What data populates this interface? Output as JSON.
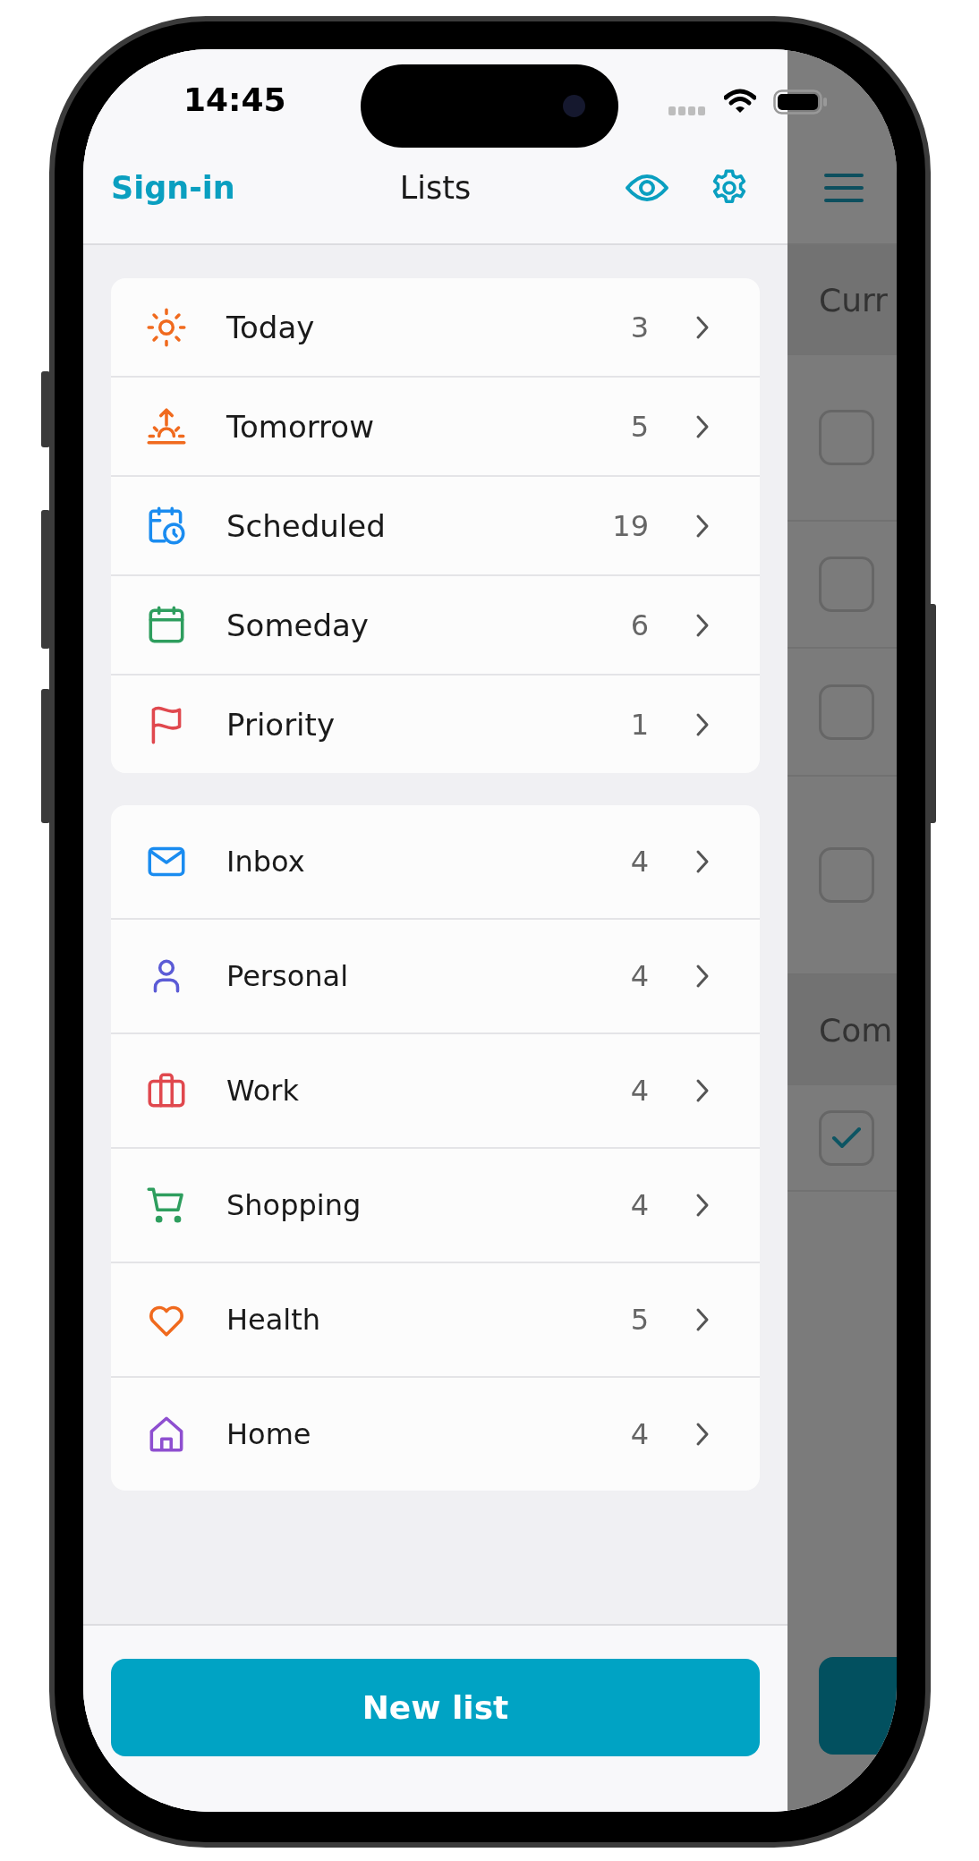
{
  "status_bar": {
    "time": "14:45"
  },
  "header": {
    "sign_in": "Sign-in",
    "title": "Lists"
  },
  "smart_lists": [
    {
      "kind": "sun",
      "label": "Today",
      "count": "3",
      "color": "#f06a1e"
    },
    {
      "kind": "sunrise",
      "label": "Tomorrow",
      "count": "5",
      "color": "#f06a1e"
    },
    {
      "kind": "calendar-clock",
      "label": "Scheduled",
      "count": "19",
      "color": "#1a8cf0"
    },
    {
      "kind": "calendar",
      "label": "Someday",
      "count": "6",
      "color": "#2e9e5e"
    },
    {
      "kind": "flag",
      "label": "Priority",
      "count": "1",
      "color": "#e0484e"
    }
  ],
  "lists": [
    {
      "kind": "mail",
      "label": "Inbox",
      "count": "4",
      "color": "#1a8cf0"
    },
    {
      "kind": "person",
      "label": "Personal",
      "count": "4",
      "color": "#5b5bd6"
    },
    {
      "kind": "briefcase",
      "label": "Work",
      "count": "4",
      "color": "#e0484e"
    },
    {
      "kind": "cart",
      "label": "Shopping",
      "count": "4",
      "color": "#2e9e5e"
    },
    {
      "kind": "heart",
      "label": "Health",
      "count": "5",
      "color": "#f06a1e"
    },
    {
      "kind": "house",
      "label": "Home",
      "count": "4",
      "color": "#8e4fd0"
    }
  ],
  "new_list_button": "New list",
  "background_pane": {
    "sections": [
      {
        "title": "Curr",
        "tasks": [
          {
            "checked": false
          },
          {
            "checked": false
          },
          {
            "checked": false
          },
          {
            "checked": false
          }
        ]
      },
      {
        "title": "Com",
        "tasks": [
          {
            "checked": true
          }
        ]
      }
    ]
  }
}
